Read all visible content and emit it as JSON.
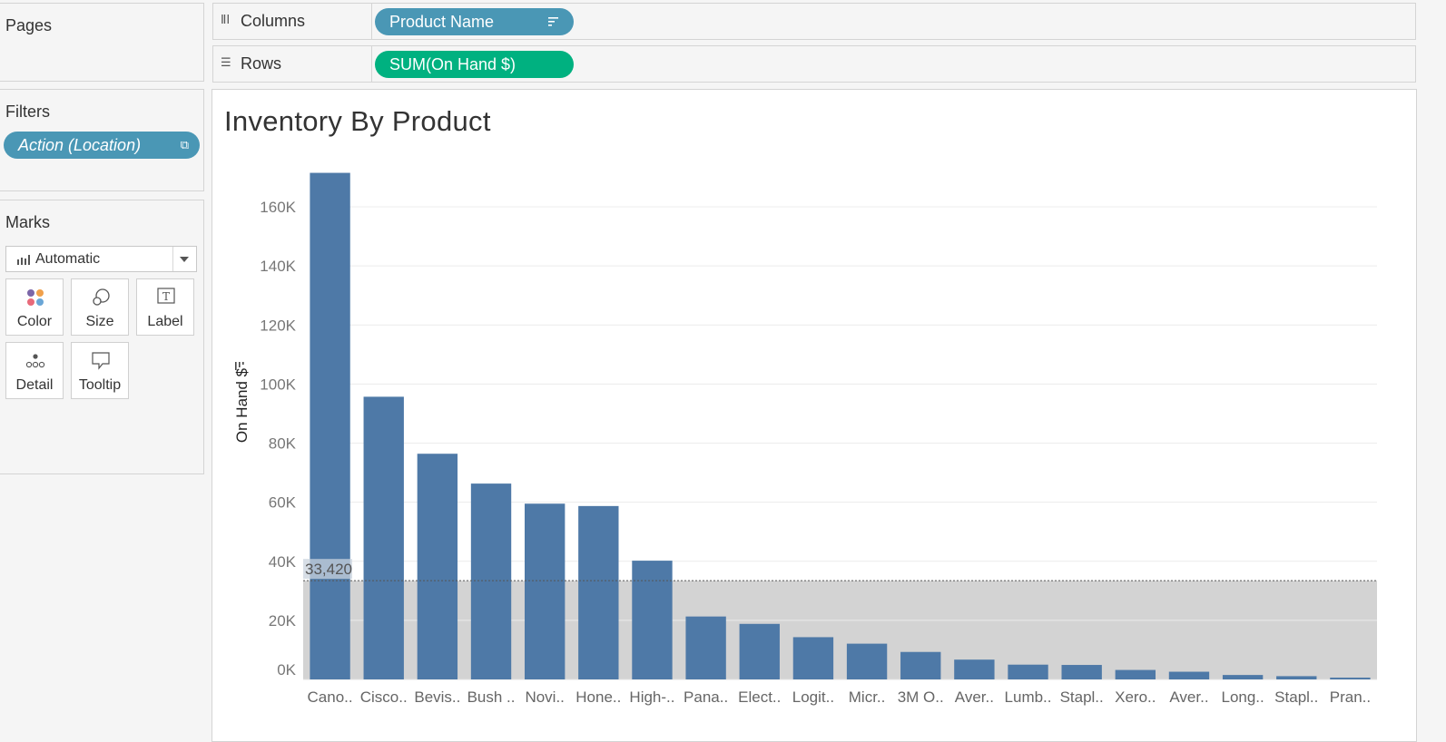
{
  "pages": {
    "title": "Pages"
  },
  "filters": {
    "title": "Filters",
    "pills": [
      "Action (Location)"
    ]
  },
  "marks": {
    "title": "Marks",
    "mark_type": "Automatic",
    "buttons": [
      "Color",
      "Size",
      "Label",
      "Detail",
      "Tooltip"
    ]
  },
  "shelves": {
    "columns": {
      "label": "Columns",
      "pill": "Product Name"
    },
    "rows": {
      "label": "Rows",
      "pill": "SUM(On Hand $)"
    }
  },
  "colors": {
    "bar": "#4e79a7",
    "pill_discrete": "#4a97b5",
    "pill_continuous": "#00b180",
    "reference_band": "#d3d3d3"
  },
  "chart_data": {
    "type": "bar",
    "title": "Inventory By Product",
    "ylabel": "On Hand $",
    "xlabel": "",
    "ylim": [
      0,
      175000
    ],
    "yticks": [
      0,
      20000,
      40000,
      60000,
      80000,
      100000,
      120000,
      140000,
      160000
    ],
    "ytick_labels": [
      "0K",
      "20K",
      "40K",
      "60K",
      "80K",
      "100K",
      "120K",
      "140K",
      "160K"
    ],
    "grid": true,
    "categories": [
      "Cano..",
      "Cisco..",
      "Bevis..",
      "Bush ..",
      "Novi..",
      "Hone..",
      "High-..",
      "Pana..",
      "Elect..",
      "Logit..",
      "Micr..",
      "3M O..",
      "Aver..",
      "Lumb..",
      "Stapl..",
      "Xero..",
      "Aver..",
      "Long..",
      "Stapl..",
      "Pran.."
    ],
    "values": [
      171500,
      95700,
      76400,
      66300,
      59500,
      58700,
      40200,
      21300,
      18800,
      14300,
      12100,
      9300,
      6700,
      5000,
      4900,
      3200,
      2600,
      1500,
      1100,
      600
    ],
    "reference_line": {
      "value": 33420,
      "label": "33,420"
    }
  }
}
